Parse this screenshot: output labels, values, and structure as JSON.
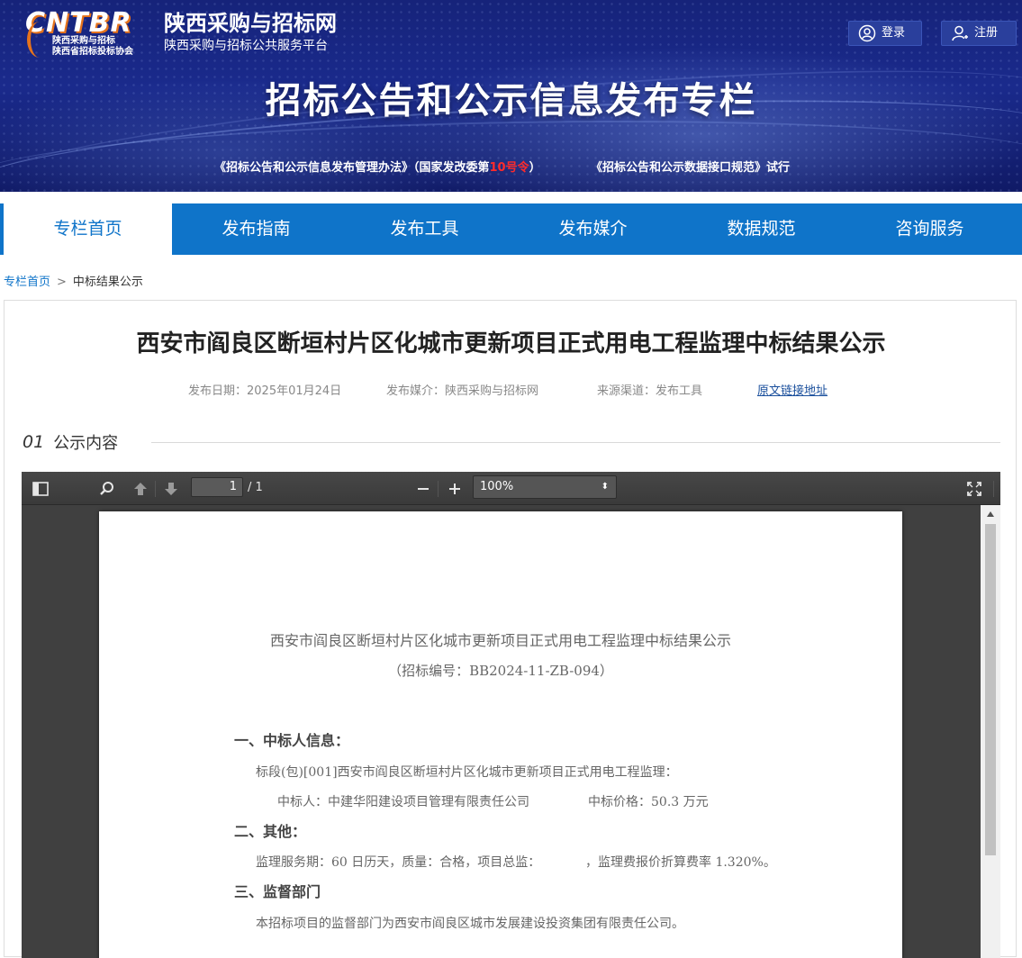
{
  "banner": {
    "logo_mark": "CNTBR",
    "logo_sub_1": "陕西采购与招标",
    "logo_sub_2": "陕西省招标投标协会",
    "site_name": "陕西采购与招标网",
    "site_subtitle": "陕西采购与招标公共服务平台",
    "login_label": "登录",
    "register_label": "注册",
    "title": "招标公告和公示信息发布专栏",
    "note_1_prefix": "《招标公告和公示信息发布管理办法》（国家发改委第",
    "note_1_highlight": "10号令",
    "note_1_suffix": "）",
    "note_2": "《招标公告和公示数据接口规范》试行"
  },
  "nav": {
    "items": [
      "专栏首页",
      "发布指南",
      "发布工具",
      "发布媒介",
      "数据规范",
      "咨询服务"
    ],
    "active_index": 0
  },
  "breadcrumb": {
    "home": "专栏首页",
    "separator": ">",
    "current": "中标结果公示"
  },
  "article": {
    "title": "西安市阎良区断垣村片区化城市更新项目正式用电工程监理中标结果公示",
    "publish_date": "发布日期：2025年01月24日",
    "media": "发布媒介：陕西采购与招标网",
    "channel": "来源渠道：发布工具",
    "original_link": "原文链接地址"
  },
  "section": {
    "number": "01",
    "label": "公示内容"
  },
  "viewer": {
    "page_current": "1",
    "page_total": "/ 1",
    "zoom": "100%",
    "zoom_arrow": "⬍"
  },
  "pdf": {
    "title": "西安市阎良区断垣村片区化城市更新项目正式用电工程监理中标结果公示",
    "code": "（招标编号：BB2024-11-ZB-094）",
    "h1": "一、中标人信息：",
    "p1": "标段(包)[001]西安市阎良区断垣村片区化城市更新项目正式用电工程监理：",
    "p2_winner": "中标人：中建华阳建设项目管理有限责任公司",
    "p2_price": "中标价格：50.3 万元",
    "h2": "二、其他：",
    "p3_left": "监理服务期：60 日历天，质量：合格，项目总监：",
    "p3_right": "，监理费报价折算费率 1.320%。",
    "h3": "三、监督部门",
    "p4": "本招标项目的监督部门为西安市阎良区城市发展建设投资集团有限责任公司。"
  },
  "colors": {
    "nav_blue": "#0f74c9",
    "banner_blue": "#16237a",
    "highlight_red": "#ff2b2b"
  }
}
